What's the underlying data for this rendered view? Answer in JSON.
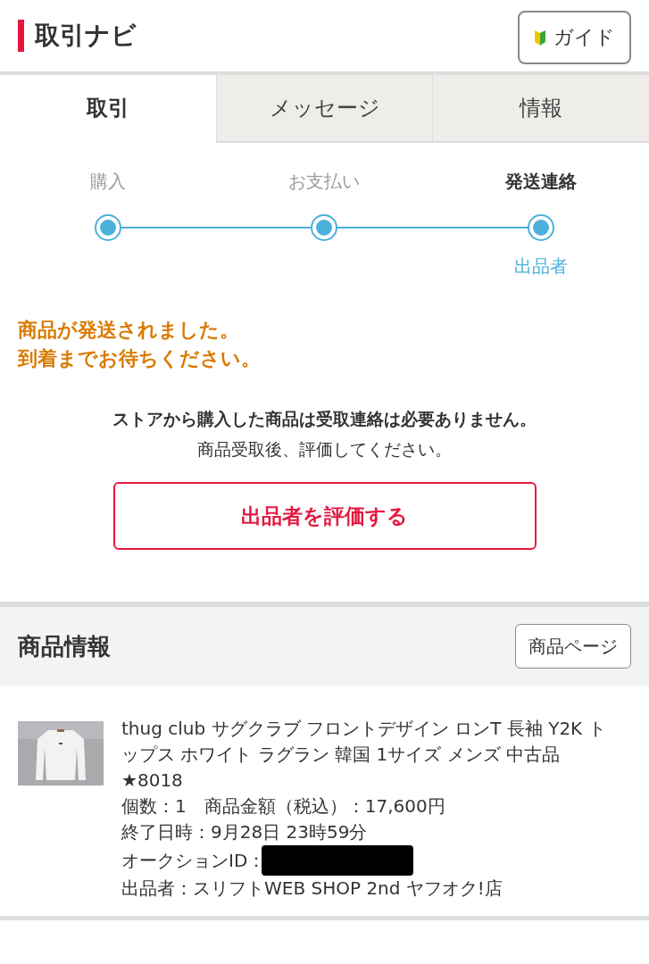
{
  "header": {
    "title": "取引ナビ",
    "guide_button": "ガイド"
  },
  "tabs": [
    {
      "label": "取引",
      "selected": true
    },
    {
      "label": "メッセージ",
      "selected": false
    },
    {
      "label": "情報",
      "selected": false
    }
  ],
  "steps": [
    {
      "label": "購入",
      "current": false
    },
    {
      "label": "お支払い",
      "current": false
    },
    {
      "label": "発送連絡",
      "current": true,
      "sublabel": "出品者"
    }
  ],
  "notice": [
    "商品が発送されました。",
    "到着までお待ちください。"
  ],
  "info": {
    "bold": "ストアから購入した商品は受取連絡は必要ありません。",
    "text": "商品受取後、評価してください。"
  },
  "rate_button": "出品者を評価する",
  "product_section": {
    "title": "商品情報",
    "page_button": "商品ページ"
  },
  "product": {
    "kind": "picture",
    "title": "thug club サグクラブ フロントデザイン ロンT 長袖 Y2K トップス ホワイト ラグラン 韓国 1サイズ メンズ 中古品 ★8018",
    "details": [
      {
        "kind": "text",
        "text": "個数：1　商品金額（税込）：17,600円"
      },
      {
        "kind": "text",
        "text": "終了日時：9月28日 23時59分"
      },
      {
        "kind": "redacted",
        "text": "オークションID："
      },
      {
        "kind": "text",
        "text": "出品者：スリフトWEB SHOP 2nd ヤフオク!店"
      }
    ]
  }
}
